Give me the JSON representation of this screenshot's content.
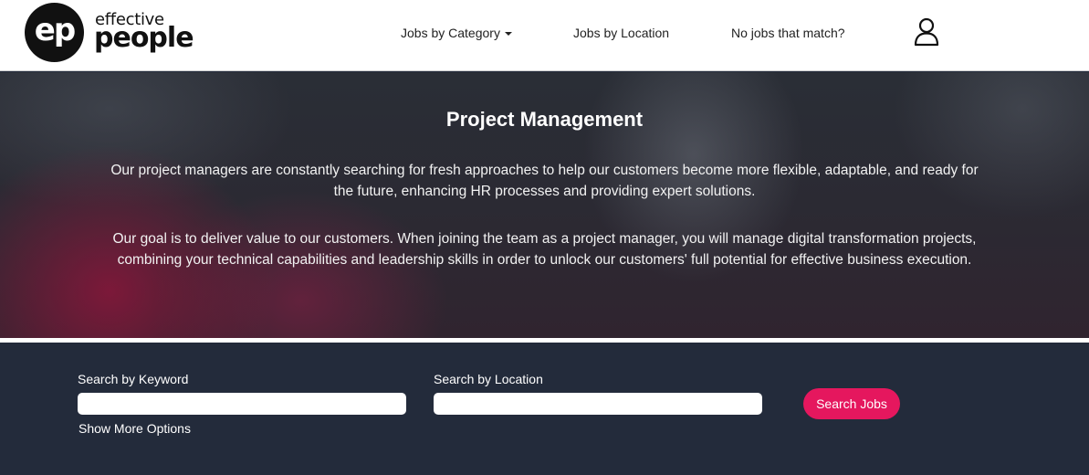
{
  "brand": {
    "logo_mark": "ep",
    "logo_line1": "effective",
    "logo_line2": "people"
  },
  "nav": {
    "items": [
      {
        "label": "Jobs by Category",
        "has_dropdown": true
      },
      {
        "label": "Jobs by Location"
      },
      {
        "label": "No jobs that match?"
      }
    ],
    "account_icon": "user-icon"
  },
  "hero": {
    "title": "Project Management",
    "paragraphs": [
      "Our project managers are constantly searching for fresh approaches to help our customers become more flexible, adaptable, and ready for the future, enhancing HR processes and providing expert solutions.",
      "Our goal is to deliver value to our customers. When joining the team as a project manager, you will manage digital transformation projects, combining your technical capabilities and leadership skills in order to unlock our customers' full potential for effective business execution."
    ]
  },
  "search": {
    "keyword_label": "Search by Keyword",
    "keyword_value": "",
    "location_label": "Search by Location",
    "location_value": "",
    "more_options_label": "Show More Options",
    "submit_label": "Search Jobs"
  },
  "colors": {
    "accent": "#e5175e",
    "search_bg": "#232b3b",
    "header_bg": "#ffffff"
  }
}
